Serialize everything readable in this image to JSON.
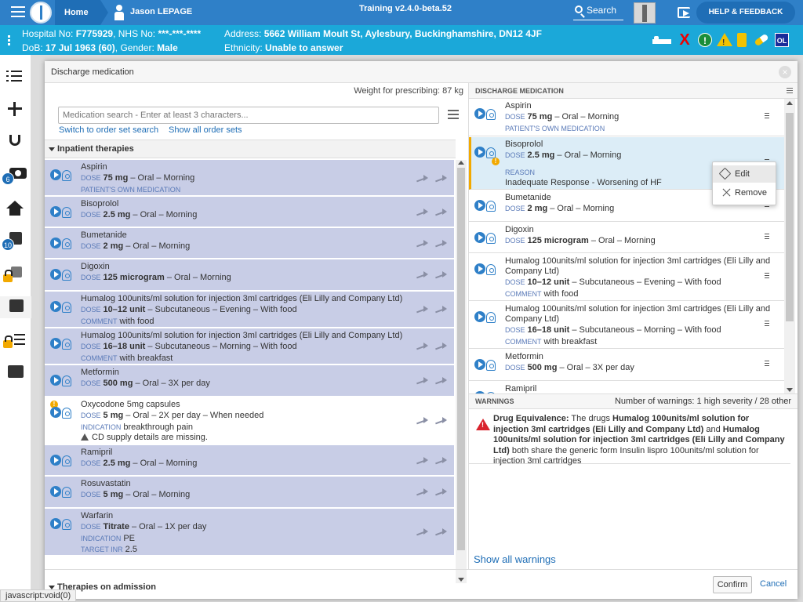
{
  "topbar": {
    "home_label": "Home",
    "user_name": "Jason LEPAGE",
    "version": "Training v2.4.0-beta.52",
    "search_label": "Search",
    "help_label": "HELP & FEEDBACK"
  },
  "banner": {
    "hospital_no_label": "Hospital No:",
    "hospital_no": "F775929",
    "nhs_no_label": "NHS No:",
    "nhs_no": "***-***-****",
    "dob_label": "DoB:",
    "dob": "17 Jul 1963 (60)",
    "gender_label": "Gender:",
    "gender": "Male",
    "address_label": "Address:",
    "address": "5662 William Moult St, Aylesbury, Buckinghamshire, DN12 4JF",
    "ethnicity_label": "Ethnicity:",
    "ethnicity": "Unable to answer",
    "red_x": "X",
    "green_bang": "!",
    "yellow_bang": "!",
    "ol_badge": "OL"
  },
  "nav": {
    "badge_camera": "6",
    "badge_edit": "10"
  },
  "status_bar": "javascript:void(0)",
  "modal": {
    "title": "Discharge medication",
    "close": "×",
    "weight": "Weight for prescribing: 87 kg",
    "search_placeholder": "Medication search - Enter at least 3 characters...",
    "link_order_set_search": "Switch to order set search",
    "link_show_order_sets": "Show all order sets",
    "section_inpatient": "Inpatient therapies",
    "section_admission": "Therapies on admission",
    "confirm": "Confirm",
    "cancel": "Cancel"
  },
  "inpatient": [
    {
      "name": "Aspirin",
      "dose_label": "DOSE",
      "dose_value": "75 mg",
      "dose_rest": " – Oral – Morning",
      "sub_label": "PATIENT'S OWN MEDICATION",
      "sub_value": ""
    },
    {
      "name": "Bisoprolol",
      "dose_label": "DOSE",
      "dose_value": "2.5 mg",
      "dose_rest": " – Oral – Morning"
    },
    {
      "name": "Bumetanide",
      "dose_label": "DOSE",
      "dose_value": "2 mg",
      "dose_rest": " – Oral – Morning"
    },
    {
      "name": "Digoxin",
      "dose_label": "DOSE",
      "dose_value": "125 microgram",
      "dose_rest": " – Oral – Morning"
    },
    {
      "name": "Humalog 100units/ml solution for injection 3ml cartridges (Eli Lilly and Company Ltd)",
      "dose_label": "DOSE",
      "dose_value": "10–12 unit",
      "dose_rest": " – Subcutaneous – Evening – With food",
      "sub_label": "COMMENT",
      "sub_value": "with food"
    },
    {
      "name": "Humalog 100units/ml solution for injection 3ml cartridges (Eli Lilly and Company Ltd)",
      "dose_label": "DOSE",
      "dose_value": "16–18 unit",
      "dose_rest": " – Subcutaneous – Morning – With food",
      "sub_label": "COMMENT",
      "sub_value": "with breakfast"
    },
    {
      "name": "Metformin",
      "dose_label": "DOSE",
      "dose_value": "500 mg",
      "dose_rest": " – Oral – 3X per day"
    },
    {
      "name": "Oxycodone 5mg capsules",
      "dose_label": "DOSE",
      "dose_value": "5 mg",
      "dose_rest": " – Oral – 2X per day – When needed",
      "sub_label": "INDICATION",
      "sub_value": "breakthrough pain",
      "note": "CD supply details are missing.",
      "warn": "!"
    },
    {
      "name": "Ramipril",
      "dose_label": "DOSE",
      "dose_value": "2.5 mg",
      "dose_rest": " – Oral – Morning"
    },
    {
      "name": "Rosuvastatin",
      "dose_label": "DOSE",
      "dose_value": "5 mg",
      "dose_rest": " – Oral – Morning"
    },
    {
      "name": "Warfarin",
      "dose_label": "DOSE",
      "dose_value": "Titrate",
      "dose_rest": " – Oral – 1X per day",
      "sub_label": "INDICATION",
      "sub_value": "PE",
      "sub2_label": "TARGET INR",
      "sub2_value": "2.5"
    }
  ],
  "discharge": {
    "header": "DISCHARGE MEDICATION",
    "items": [
      {
        "name": "Aspirin",
        "dose_label": "DOSE",
        "dose_value": "75 mg",
        "dose_rest": " – Oral – Morning",
        "sub_label": "PATIENT'S OWN MEDICATION"
      },
      {
        "name": "Bisoprolol",
        "dose_label": "DOSE",
        "dose_value": "2.5 mg",
        "dose_rest": " – Oral – Morning",
        "reason_label": "REASON",
        "reason_value": "Inadequate Response - Worsening of HF",
        "warn": "!"
      },
      {
        "name": "Bumetanide",
        "dose_label": "DOSE",
        "dose_value": "2 mg",
        "dose_rest": " – Oral – Morning"
      },
      {
        "name": "Digoxin",
        "dose_label": "DOSE",
        "dose_value": "125 microgram",
        "dose_rest": " – Oral – Morning"
      },
      {
        "name": "Humalog 100units/ml solution for injection 3ml cartridges (Eli Lilly and",
        "name2": "Company Ltd)",
        "dose_label": "DOSE",
        "dose_value": "10–12 unit",
        "dose_rest": " – Subcutaneous – Evening – With food",
        "sub_label": "COMMENT",
        "sub_value": "with food"
      },
      {
        "name": "Humalog 100units/ml solution for injection 3ml cartridges (Eli Lilly and",
        "name2": "Company Ltd)",
        "dose_label": "DOSE",
        "dose_value": "16–18 unit",
        "dose_rest": " – Subcutaneous – Morning – With food",
        "sub_label": "COMMENT",
        "sub_value": "with breakfast"
      },
      {
        "name": "Metformin",
        "dose_label": "DOSE",
        "dose_value": "500 mg",
        "dose_rest": " – Oral – 3X per day"
      },
      {
        "name": "Ramipril"
      }
    ],
    "context_menu": {
      "edit": "Edit",
      "remove": "Remove"
    }
  },
  "warnings": {
    "header": "WARNINGS",
    "count": "Number of warnings: 1 high severity / 28 other",
    "triangle": "!",
    "title": "Drug Equivalence:",
    "t1": " The drugs ",
    "drug1": "Humalog 100units/ml solution for injection 3ml cartridges (Eli Lilly and Company Ltd)",
    "t2": " and ",
    "drug2": "Humalog 100units/ml solution for injection 3ml cartridges (Eli Lilly and Company Ltd)",
    "t3": " both share the generic form Insulin lispro 100units/ml solution for injection 3ml cartridges",
    "show_all": "Show all warnings"
  }
}
